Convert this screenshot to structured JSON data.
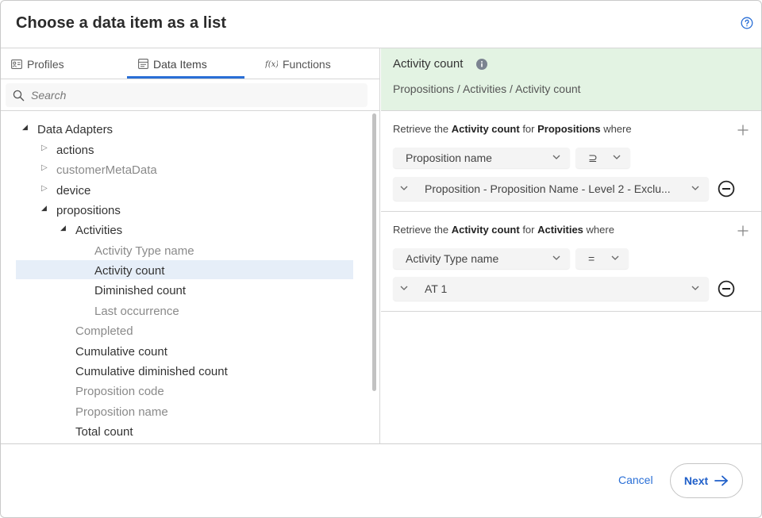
{
  "dialog": {
    "title": "Choose a data item as a list",
    "help_icon": "help-circle-icon"
  },
  "tabs": [
    {
      "label": "Profiles",
      "icon": "profile-card-icon"
    },
    {
      "label": "Data Items",
      "icon": "data-items-icon",
      "active": true
    },
    {
      "label": "Functions",
      "icon": "function-fx-icon"
    }
  ],
  "search": {
    "placeholder": "Search",
    "value": ""
  },
  "tree": {
    "root": "Data Adapters",
    "actions": "actions",
    "customerMetaData": "customerMetaData",
    "device": "device",
    "propositions": "propositions",
    "activities": "Activities",
    "activity_type_name": "Activity Type name",
    "activity_count": "Activity count",
    "diminished_count": "Diminished count",
    "last_occurrence": "Last occurrence",
    "completed": "Completed",
    "cumulative_count": "Cumulative count",
    "cumulative_diminished_count": "Cumulative diminished count",
    "proposition_code": "Proposition code",
    "proposition_name": "Proposition name",
    "total_count": "Total count"
  },
  "summary": {
    "title": "Activity count",
    "path": "Propositions / Activities / Activity count"
  },
  "conditions": [
    {
      "prefix": "Retrieve the",
      "item": "Activity count",
      "for_word": "for",
      "entity": "Propositions",
      "suffix": "where",
      "field": "Proposition name",
      "operator": "⊇",
      "value": "Proposition - Proposition Name - Level 2 - Exclu..."
    },
    {
      "prefix": "Retrieve the",
      "item": "Activity count",
      "for_word": "for",
      "entity": "Activities",
      "suffix": "where",
      "field": "Activity Type name",
      "operator": "=",
      "value": "AT 1"
    }
  ],
  "footer": {
    "cancel_label": "Cancel",
    "next_label": "Next"
  },
  "colors": {
    "accent": "#2a6fd6",
    "summary_bg": "#e3f3e3",
    "selected_bg": "#e6eef8"
  }
}
